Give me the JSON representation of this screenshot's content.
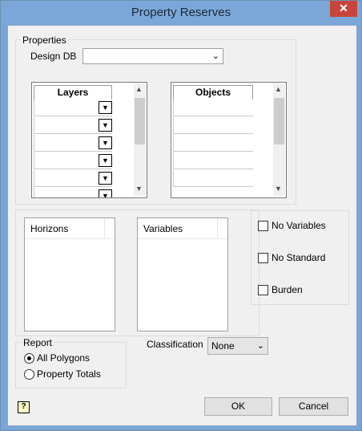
{
  "window": {
    "title": "Property Reserves",
    "close_label": "✕"
  },
  "properties": {
    "group_label": "Properties",
    "design_db_label": "Design DB",
    "design_db_value": "",
    "layers_header": "Layers",
    "objects_header": "Objects"
  },
  "horizons_header": "Horizons",
  "variables_header": "Variables",
  "options": {
    "no_variables": "No Variables",
    "no_standard": "No Standard",
    "burden": "Burden"
  },
  "report": {
    "group_label": "Report",
    "all_polygons": "All Polygons",
    "property_totals": "Property Totals",
    "selected": "All Polygons"
  },
  "classification": {
    "label": "Classification",
    "value": "None"
  },
  "buttons": {
    "ok": "OK",
    "cancel": "Cancel",
    "help": "?"
  }
}
